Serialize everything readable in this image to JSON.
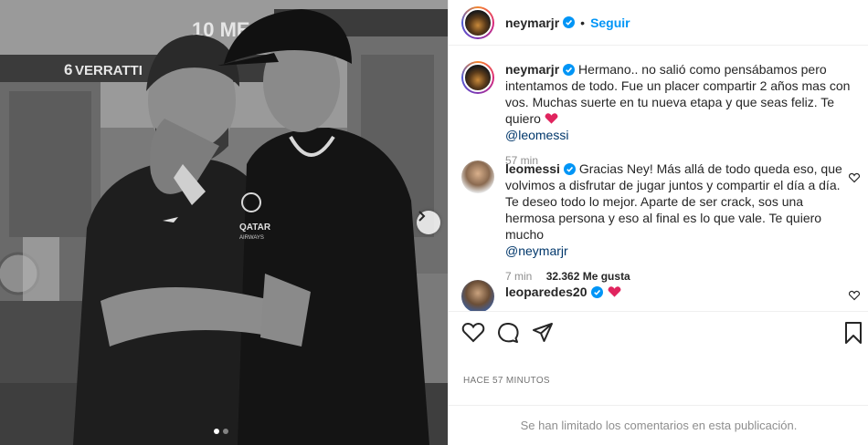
{
  "post": {
    "author": "neymarjr",
    "follow_label": "Seguir",
    "separator": "•",
    "caption_author": "neymarjr",
    "caption_text": "Hermano.. no salió como pensábamos pero intentamos de todo. Fue un placer compartir 2 años mas con vos. Muchas suerte en tu nueva etapa y que seas feliz. Te quiero ",
    "caption_mention": "@leomessi",
    "caption_time": "57 min",
    "timestamp": "HACE 57 MINUTOS",
    "comments_limited": "Se han limitado los comentarios en esta publicación."
  },
  "photo": {
    "locker_name": "VERRATTI",
    "locker_number": "6",
    "locker_partial": "10 ME",
    "jersey_brand": "QATAR",
    "jersey_brand_sub": "AIRWAYS"
  },
  "comments": [
    {
      "user": "leomessi",
      "text": "Gracias Ney! Más allá de todo queda eso, que volvimos a disfrutar de jugar juntos y compartir el día a día. Te deseo todo lo mejor. Aparte de ser crack, sos una hermosa persona y eso al final es lo que vale. Te quiero mucho ",
      "mention": "@neymarjr",
      "time": "7 min",
      "likes": "32.362 Me gusta"
    },
    {
      "user": "leoparedes20"
    }
  ],
  "icons": {
    "verified": "verified-badge-icon",
    "heart_red": "red-heart-emoji",
    "like": "heart-outline-icon",
    "comment": "speech-bubble-icon",
    "share": "paper-plane-icon",
    "save": "bookmark-icon",
    "next": "chevron-right-icon"
  },
  "colors": {
    "accent": "#0095f6",
    "heart": "#ed4956",
    "mention": "#00376b",
    "muted": "#8e8e8e"
  }
}
